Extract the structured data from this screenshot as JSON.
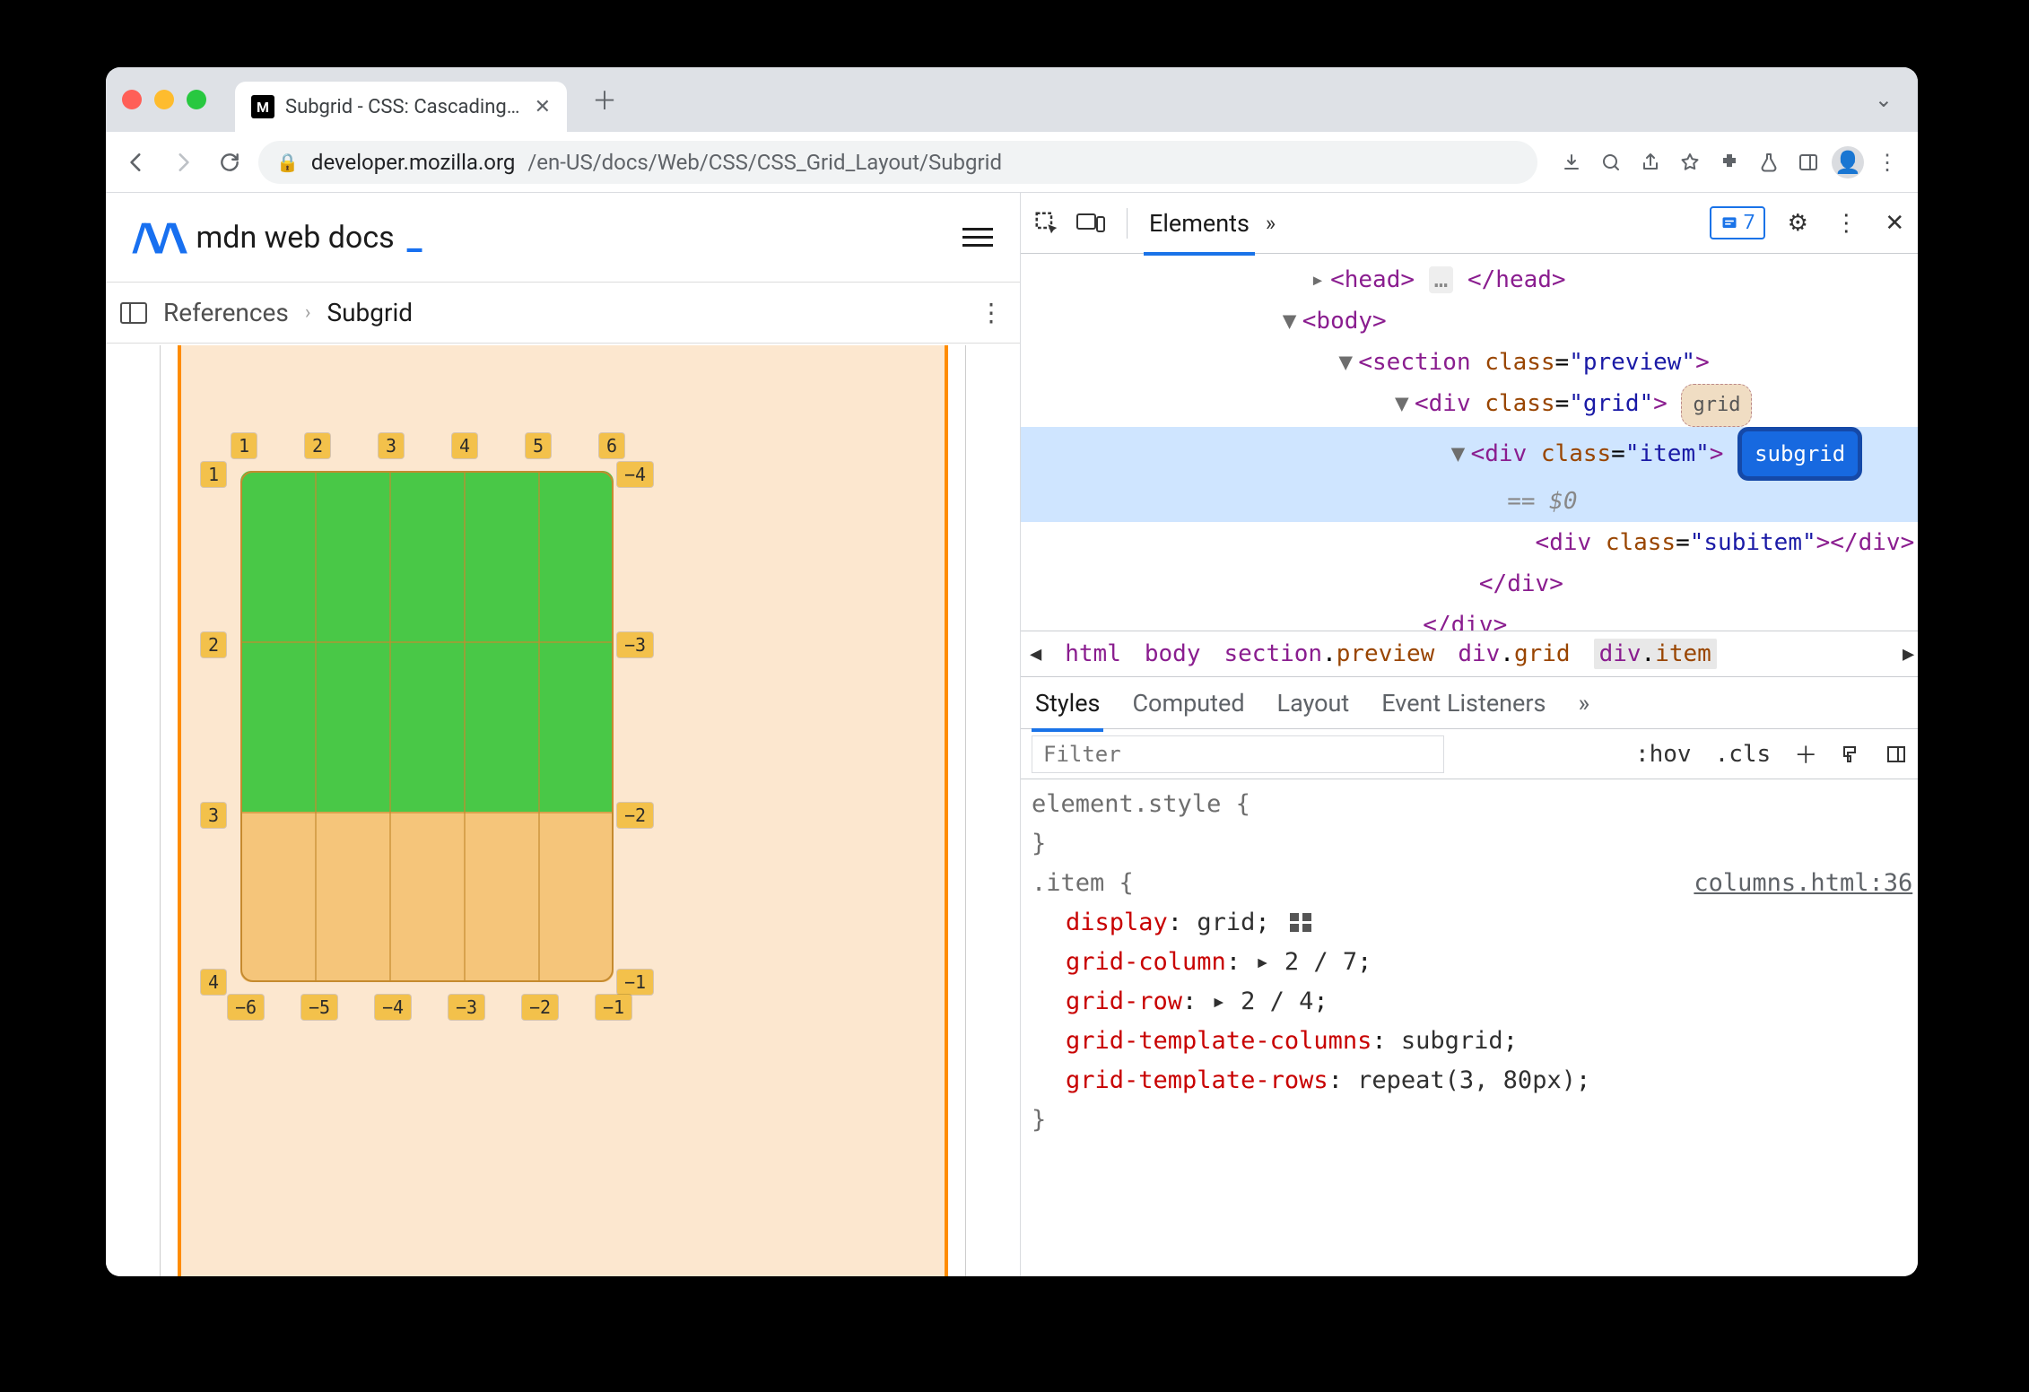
{
  "tab": {
    "title": "Subgrid - CSS: Cascading Style"
  },
  "url": {
    "host": "developer.mozilla.org",
    "path": "/en-US/docs/Web/CSS/CSS_Grid_Layout/Subgrid"
  },
  "mdn": {
    "brand": "mdn web docs",
    "crumb_root": "References",
    "crumb_current": "Subgrid"
  },
  "gridlabels": {
    "top": [
      "1",
      "2",
      "3",
      "4",
      "5",
      "6"
    ],
    "left": [
      "1",
      "2",
      "3",
      "4"
    ],
    "right": [
      "−4",
      "−3",
      "−2",
      "−1"
    ],
    "bottom": [
      "−6",
      "−5",
      "−4",
      "−3",
      "−2",
      "−1"
    ]
  },
  "devtools": {
    "panel": "Elements",
    "issue_count": "7",
    "dom": {
      "head_open": "<head>",
      "head_ell": "…",
      "head_close": "</head>",
      "body": "<body>",
      "section": "<section class=\"preview\">",
      "grid": "<div class=\"grid\">",
      "grid_pill": "grid",
      "item": "<div class=\"item\">",
      "item_pill": "subgrid",
      "eq0": "== $0",
      "subitem": "<div class=\"subitem\"></div>",
      "item_close": "</div>",
      "grid_close": "</div>"
    },
    "crumbs": [
      "html",
      "body",
      "section.preview",
      "div.grid",
      "div.item"
    ],
    "styles_tabs": [
      "Styles",
      "Computed",
      "Layout",
      "Event Listeners"
    ],
    "filter_placeholder": "Filter",
    "hov": ":hov",
    "cls": ".cls",
    "rules": {
      "element_style": "element.style {",
      "brace_close": "}",
      "item_sel": ".item {",
      "source": "columns.html:36",
      "lines": [
        {
          "p": "display",
          "v": "grid",
          "grid_icon": true
        },
        {
          "p": "grid-column",
          "v": "▸ 2 / 7"
        },
        {
          "p": "grid-row",
          "v": "▸ 2 / 4"
        },
        {
          "p": "grid-template-columns",
          "v": "subgrid"
        },
        {
          "p": "grid-template-rows",
          "v": "repeat(3, 80px)"
        }
      ]
    }
  }
}
